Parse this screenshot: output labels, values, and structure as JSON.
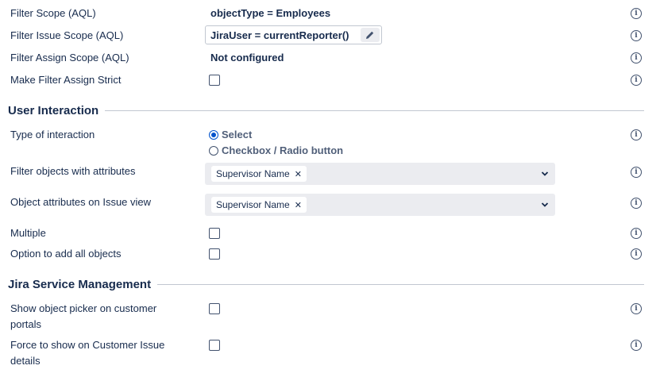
{
  "rows": {
    "filter_scope": {
      "label": "Filter Scope (AQL)",
      "value": "objectType = Employees"
    },
    "filter_issue_scope": {
      "label": "Filter Issue Scope (AQL)",
      "value": "JiraUser = currentReporter()"
    },
    "filter_assign_scope": {
      "label": "Filter Assign Scope (AQL)",
      "value": "Not configured"
    },
    "make_filter_assign_strict": {
      "label": "Make Filter Assign Strict",
      "checked": false
    }
  },
  "user_interaction": {
    "title": "User Interaction",
    "type_of_interaction": {
      "label": "Type of interaction",
      "options": [
        "Select",
        "Checkbox / Radio button"
      ],
      "selected": "Select"
    },
    "filter_objects": {
      "label": "Filter objects with attributes",
      "tag": "Supervisor Name"
    },
    "object_attributes": {
      "label": "Object attributes on Issue view",
      "tag": "Supervisor Name"
    },
    "multiple": {
      "label": "Multiple",
      "checked": false
    },
    "add_all": {
      "label": "Option to add all objects",
      "checked": false
    }
  },
  "jsm": {
    "title": "Jira Service Management",
    "show_picker": {
      "label_line1": "Show object picker on customer",
      "label_line2": "portals",
      "checked": false
    },
    "force_show": {
      "label_line1": "Force to show on Customer Issue",
      "label_line2": "details",
      "checked": false
    }
  },
  "info_glyph": "i",
  "colors": {
    "accent": "#0052cc",
    "text": "#172b4d",
    "select_bg": "#ebecf0"
  }
}
